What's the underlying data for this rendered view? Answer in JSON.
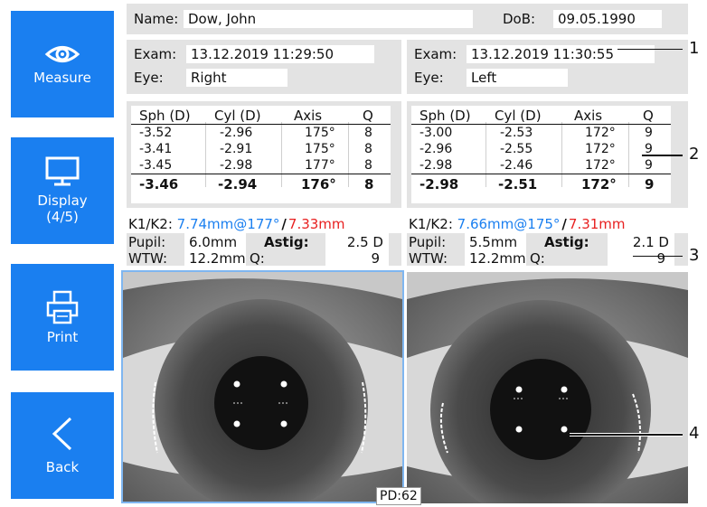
{
  "sidebar": {
    "measure": {
      "label": "Measure",
      "icon": "eye-icon"
    },
    "display": {
      "label": "Display",
      "sublabel": "(4/5)",
      "icon": "monitor-icon"
    },
    "print": {
      "label": "Print",
      "icon": "printer-icon"
    },
    "back": {
      "label": "Back",
      "icon": "chevron-left-icon"
    }
  },
  "patient": {
    "name_label": "Name:",
    "name": "Dow, John",
    "dob_label": "DoB:",
    "dob": "09.05.1990"
  },
  "right_eye": {
    "exam_label": "Exam:",
    "exam": "13.12.2019 11:29:50",
    "eye_label": "Eye:",
    "eye": "Right",
    "headers": [
      "Sph (D)",
      "Cyl (D)",
      "Axis",
      "Q"
    ],
    "rows": [
      [
        "-3.52",
        "-2.96",
        "175°",
        "8"
      ],
      [
        "-3.41",
        "-2.91",
        "175°",
        "8"
      ],
      [
        "-3.45",
        "-2.98",
        "177°",
        "8"
      ]
    ],
    "summary": [
      "-3.46",
      "-2.94",
      "176°",
      "8"
    ],
    "k_label": "K1/K2:",
    "k1": "7.74mm@177°",
    "k_sep": "/",
    "k2": "7.33mm",
    "pupil_label": "Pupil:",
    "pupil": "6.0mm",
    "astig_label": "Astig:",
    "astig": "2.5 D",
    "wtw_label": "WTW:",
    "wtw": "12.2mm",
    "q_label": "Q:",
    "q": "9"
  },
  "left_eye": {
    "exam_label": "Exam:",
    "exam": "13.12.2019 11:30:55",
    "eye_label": "Eye:",
    "eye": "Left",
    "headers": [
      "Sph (D)",
      "Cyl (D)",
      "Axis",
      "Q"
    ],
    "rows": [
      [
        "-3.00",
        "-2.53",
        "172°",
        "9"
      ],
      [
        "-2.96",
        "-2.55",
        "172°",
        "9"
      ],
      [
        "-2.98",
        "-2.46",
        "172°",
        "9"
      ]
    ],
    "summary": [
      "-2.98",
      "-2.51",
      "172°",
      "9"
    ],
    "k_label": "K1/K2:",
    "k1": "7.66mm@175°",
    "k_sep": "/",
    "k2": "7.31mm",
    "pupil_label": "Pupil:",
    "pupil": "5.5mm",
    "astig_label": "Astig:",
    "astig": "2.1 D",
    "wtw_label": "WTW:",
    "wtw": "12.2mm",
    "q_label": "Q:",
    "q": "9"
  },
  "pd": "PD:62",
  "callouts": [
    "1",
    "2",
    "3",
    "4"
  ],
  "colors": {
    "accent": "#1a7ff0",
    "k1": "#1a7ff0",
    "k2": "#e82020",
    "panel": "#e3e3e3"
  }
}
